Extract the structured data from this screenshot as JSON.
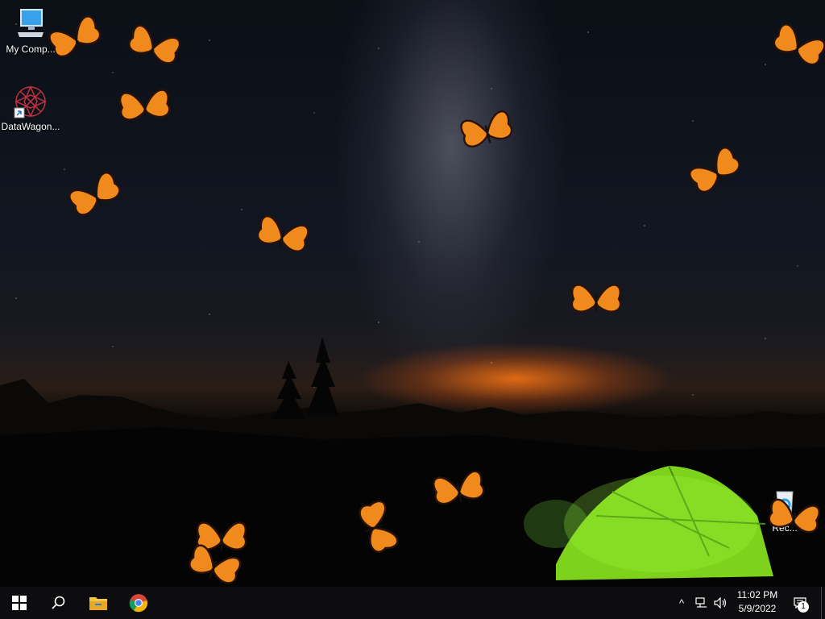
{
  "desktop": {
    "icons": [
      {
        "label": "My Comp...",
        "icon": "computer-icon"
      },
      {
        "label": "DataWagon...",
        "icon": "datawagon-icon"
      },
      {
        "label": "Rec...",
        "icon": "recycle-bin-icon"
      }
    ],
    "wallpaper": "night sky with milky way, mountains and glowing green tent",
    "butterfly_color": "#f08a1c"
  },
  "taskbar": {
    "start": {
      "icon": "windows-start-icon"
    },
    "search": {
      "icon": "search-icon"
    },
    "pinned": [
      {
        "name": "File Explorer",
        "icon": "folder-icon"
      },
      {
        "name": "Google Chrome",
        "icon": "chrome-icon"
      }
    ],
    "tray": {
      "chevron": "^",
      "network_icon": "network-icon",
      "volume_icon": "volume-icon",
      "time": "11:02 PM",
      "date": "5/9/2022",
      "notification_count": "1"
    }
  }
}
